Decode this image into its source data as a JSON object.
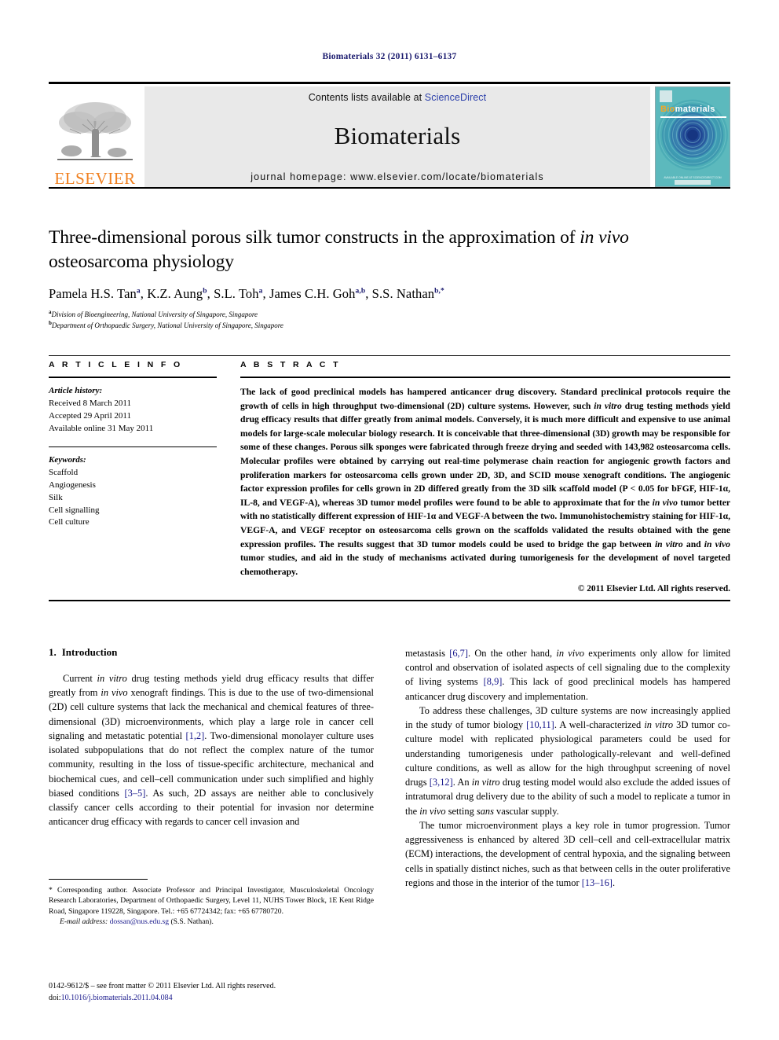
{
  "running_head": "Biomaterials 32 (2011) 6131–6137",
  "masthead": {
    "publisher_wordmark": "ELSEVIER",
    "contents_prefix": "Contents lists available at ",
    "sciencedirect": "ScienceDirect",
    "journal_name": "Biomaterials",
    "homepage": "journal homepage: www.elsevier.com/locate/biomaterials",
    "cover": {
      "title_part1": "Bio",
      "title_part2": "materials",
      "footer_text": "AVAILABLE ONLINE AT SCIENCEDIRECT.COM"
    },
    "colors": {
      "elsevier_orange": "#f08020",
      "sciencedirect_blue": "#2b3faa",
      "band_gray": "#e9e9e9",
      "cover_teal": "#56b3b8"
    }
  },
  "article": {
    "title": "Three-dimensional porous silk tumor constructs in the approximation of in vivo osteosarcoma physiology",
    "title_italic_part": "in vivo",
    "authors_plain": "Pamela H.S. Tan a, K.Z. Aung b, S.L. Toh a, James C.H. Goh a,b, S.S. Nathan b,*",
    "authors": [
      {
        "name": "Pamela H.S. Tan",
        "sup": "a"
      },
      {
        "name": "K.Z. Aung",
        "sup": "b"
      },
      {
        "name": "S.L. Toh",
        "sup": "a"
      },
      {
        "name": "James C.H. Goh",
        "sup": "a,b"
      },
      {
        "name": "S.S. Nathan",
        "sup": "b,*"
      }
    ],
    "affiliations": [
      {
        "marker": "a",
        "text": "Division of Bioengineering, National University of Singapore, Singapore"
      },
      {
        "marker": "b",
        "text": "Department of Orthopaedic Surgery, National University of Singapore, Singapore"
      }
    ]
  },
  "article_info": {
    "heading": "A R T I C L E   I N F O",
    "history_label": "Article history:",
    "history": [
      "Received 8 March 2011",
      "Accepted 29 April 2011",
      "Available online 31 May 2011"
    ],
    "keywords_label": "Keywords:",
    "keywords": [
      "Scaffold",
      "Angiogenesis",
      "Silk",
      "Cell signalling",
      "Cell culture"
    ]
  },
  "abstract": {
    "heading": "A B S T R A C T",
    "paragraph_pre_italic1": "The lack of good preclinical models has hampered anticancer drug discovery. Standard preclinical protocols require the growth of cells in high throughput two-dimensional (2D) culture systems. However, such ",
    "italic1": "in vitro",
    "paragraph_mid1": " drug testing methods yield drug efficacy results that differ greatly from animal models. Conversely, it is much more difficult and expensive to use animal models for large-scale molecular biology research. It is conceivable that three-dimensional (3D) growth may be responsible for some of these changes. Porous silk sponges were fabricated through freeze drying and seeded with 143,982 osteosarcoma cells. Molecular profiles were obtained by carrying out real-time polymerase chain reaction for angiogenic growth factors and proliferation markers for osteosarcoma cells grown under 2D, 3D, and SCID mouse xenograft conditions. The angiogenic factor expression profiles for cells grown in 2D differed greatly from the 3D silk scaffold model (P < 0.05 for bFGF, HIF-1α, IL-8, and VEGF-A), whereas 3D tumor model profiles were found to be able to approximate that for the ",
    "italic2": "in vivo",
    "paragraph_mid2": " tumor better with no statistically different expression of HIF-1α and VEGF-A between the two. Immunohistochemistry staining for HIF-1α, VEGF-A, and VEGF receptor on osteosarcoma cells grown on the scaffolds validated the results obtained with the gene expression profiles. The results suggest that 3D tumor models could be used to bridge the gap between ",
    "italic3": "in vitro",
    "paragraph_mid3": " and ",
    "italic4": "in vivo",
    "paragraph_end": " tumor studies, and aid in the study of mechanisms activated during tumorigenesis for the development of novel targeted chemotherapy.",
    "copyright": "© 2011 Elsevier Ltd. All rights reserved."
  },
  "introduction": {
    "number": "1.",
    "title": "Introduction",
    "left_p1_a": "Current ",
    "left_p1_i1": "in vitro",
    "left_p1_b": " drug testing methods yield drug efficacy results that differ greatly from ",
    "left_p1_i2": "in vivo",
    "left_p1_c": " xenograft findings. This is due to the use of two-dimensional (2D) cell culture systems that lack the mechanical and chemical features of three-dimensional (3D) microenvironments, which play a large role in cancer cell signaling and metastatic potential ",
    "left_p1_ref1": "[1,2]",
    "left_p1_d": ". Two-dimensional monolayer culture uses isolated subpopulations that do not reflect the complex nature of the tumor community, resulting in the loss of tissue-specific architecture, mechanical and biochemical cues, and cell–cell communication under such simplified and highly biased conditions ",
    "left_p1_ref2": "[3–5]",
    "left_p1_e": ". As such, 2D assays are neither able to conclusively classify cancer cells according to their potential for invasion nor determine anticancer drug efficacy with regards to cancer cell invasion and",
    "right_p1_a": "metastasis ",
    "right_p1_ref1": "[6,7]",
    "right_p1_b": ". On the other hand, ",
    "right_p1_i1": "in vivo",
    "right_p1_c": " experiments only allow for limited control and observation of isolated aspects of cell signaling due to the complexity of living systems ",
    "right_p1_ref2": "[8,9]",
    "right_p1_d": ". This lack of good preclinical models has hampered anticancer drug discovery and implementation.",
    "right_p2_a": "To address these challenges, 3D culture systems are now increasingly applied in the study of tumor biology ",
    "right_p2_ref1": "[10,11]",
    "right_p2_b": ". A well-characterized ",
    "right_p2_i1": "in vitro",
    "right_p2_c": " 3D tumor co-culture model with replicated physiological parameters could be used for understanding tumorigenesis under pathologically-relevant and well-defined culture conditions, as well as allow for the high throughput screening of novel drugs ",
    "right_p2_ref2": "[3,12]",
    "right_p2_d": ". An ",
    "right_p2_i2": "in vitro",
    "right_p2_e": " drug testing model would also exclude the added issues of intratumoral drug delivery due to the ability of such a model to replicate a tumor in the ",
    "right_p2_i3": "in vivo",
    "right_p2_f": " setting ",
    "right_p2_i4": "sans",
    "right_p2_g": " vascular supply.",
    "right_p3_a": "The tumor microenvironment plays a key role in tumor progression. Tumor aggressiveness is enhanced by altered 3D cell–cell and cell-extracellular matrix (ECM) interactions, the development of central hypoxia, and the signaling between cells in spatially distinct niches, such as that between cells in the outer proliferative regions and those in the interior of the tumor ",
    "right_p3_ref1": "[13–16]",
    "right_p3_b": "."
  },
  "footnotes": {
    "corresponding_a": "* Corresponding author. Associate Professor and Principal Investigator, Musculoskeletal Oncology Research Laboratories, Department of Orthopaedic Surgery, Level 11, NUHS Tower Block, 1E Kent Ridge Road, Singapore 119228, Singapore. Tel.: +65 67724342; fax: +65 67780720.",
    "email_label": "E-mail address:",
    "email": "dossan@nus.edu.sg",
    "email_suffix": "(S.S. Nathan).",
    "issn_line": "0142-9612/$ – see front matter © 2011 Elsevier Ltd. All rights reserved.",
    "doi_label": "doi:",
    "doi": "10.1016/j.biomaterials.2011.04.084"
  }
}
